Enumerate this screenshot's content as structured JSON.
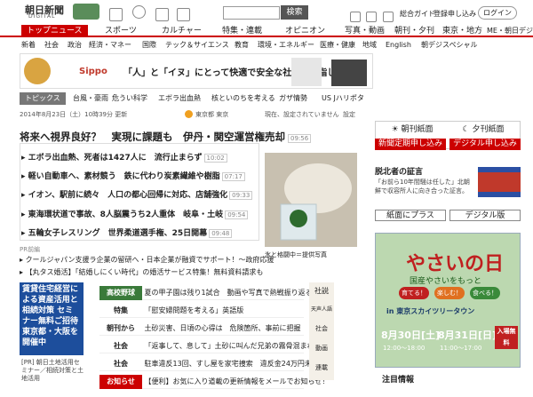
{
  "header": {
    "logo_main": "朝日新聞",
    "logo_sub": "DIGITAL",
    "search_button": "検索",
    "links": [
      "総合ガイド",
      "登録申し込み"
    ],
    "login": "ログイン"
  },
  "nav_main": [
    {
      "label": "トップニュース",
      "active": true
    },
    {
      "label": "スポーツ"
    },
    {
      "label": "カルチャー"
    },
    {
      "label": "特集・連載"
    },
    {
      "label": "オピニオン"
    },
    {
      "label": "写真・動画"
    },
    {
      "label": "朝刊・夕刊"
    },
    {
      "label": "東京・地方"
    },
    {
      "label": "ME・朝日デジ"
    }
  ],
  "nav_sub": [
    "新着",
    "社会",
    "政治",
    "経済・マネー",
    "国際",
    "テック＆サイエンス",
    "教育",
    "環境・エネルギー",
    "医療・健康",
    "地域",
    "English",
    "朝デジスペシャル"
  ],
  "banner": {
    "text": "「人」と「イヌ」にとって快適で安全な社会を目指して",
    "brand": "Sippo"
  },
  "topics": {
    "heading": "トピックス",
    "items": [
      "台風・豪雨",
      "危うい科学",
      "エボラ出血熱",
      "核といのちを考える",
      "ガザ情勢",
      "US Jハリポタ"
    ]
  },
  "dateline": {
    "date": "2014年8月23日（土）10時39分 更新",
    "location": "東京都 東京",
    "forecast": "現在、設定されていません",
    "settings": "設定"
  },
  "headline": {
    "text": "将来へ視界良好？　実現に課題も　伊丹・関空運営権売却",
    "time": "09:56"
  },
  "news": [
    {
      "text": "エボラ出血熱、死者は1427人に　流行止まらず",
      "time": "10:02"
    },
    {
      "text": "軽い自動車へ、素材競う　鉄に代わり炭素繊維や樹脂",
      "time": "07:17"
    },
    {
      "text": "イオン、駅前に続々　人口の都心回帰に対応、店舗強化",
      "time": "09:33"
    },
    {
      "text": "東海環状道で事故、8人脳震うち2人重体　岐阜・土岐",
      "time": "09:54"
    },
    {
      "text": "五輪女子レスリング　世界柔道選手権、25日開幕",
      "time": "09:48"
    }
  ],
  "photo_caption": "氷と格闘中＝提供写真",
  "pr": {
    "label": "PR前編",
    "items": [
      "クールジャパン支援ラ企業の留研へ・日本企業が融資でサポート！～政府応援",
      "【丸タス婚活】「結婚しにくい時代」の婚活サービス特集！無料資料請求も"
    ]
  },
  "ad_left": {
    "text": "賃貸住宅経営による資産活用と相続対策 セミナー無料ご招待 東京都・大阪を開催中",
    "caption": "[PR] 朝日土地活用セミナー／相続対策と土地活用"
  },
  "news_list": [
    {
      "category": "高校野球",
      "text": "夏の甲子園は残り1試合　動画や写真で熱戦振り返る",
      "style": "g"
    },
    {
      "category": "特集",
      "text": "「慰安婦問題を考える」英語版",
      "style": ""
    },
    {
      "category": "朝刊から",
      "text": "土砂災害、日頃の心得は　危険箇所、事前に把握",
      "style": ""
    },
    {
      "category": "社会",
      "text": "「返事して、息して」土砂に叫んだ兄弟の霧骨混まれる",
      "style": ""
    },
    {
      "category": "社会",
      "text": "駐車違反13回、すし屋を家宅捜索　違反金24万円未納",
      "style": ""
    },
    {
      "category": "お知らせ",
      "text": "【便利】お気に入り道載の更新情報をメールでお知らせ！",
      "style": "r"
    }
  ],
  "sidebar_mid": {
    "labels": [
      "社説",
      "天声人語",
      "社会",
      "動画",
      "連載"
    ]
  },
  "right": {
    "morning": "朝刊紙面",
    "evening": "夕刊紙面",
    "delivery": "新聞定期申し込み",
    "digital": "デジタル申し込み",
    "feature_heading": "脱北者の証言",
    "feature_text": "「お前ら10年間騒は任した」北朝鮮で収容所人に向き合った証言。",
    "plus": "紙面にプラス",
    "digital_edition": "デジタル版",
    "veg": {
      "title": "やさいの日",
      "sub": "国産やさいをもっと",
      "badges": [
        "育てる！",
        "楽しむ！",
        "食べる！"
      ],
      "place": "in 東京スカイツリータウン",
      "date1": "8月30日[土]",
      "date2": "8月31日[日]",
      "time1": "12:00～18:00",
      "time2": "11:00～17:00",
      "badge": "入場無料"
    },
    "notice": "注目情報"
  },
  "colors": {
    "brand_red": "#cc0000",
    "nav_gray": "#777777",
    "green": "#3a7a3a"
  }
}
